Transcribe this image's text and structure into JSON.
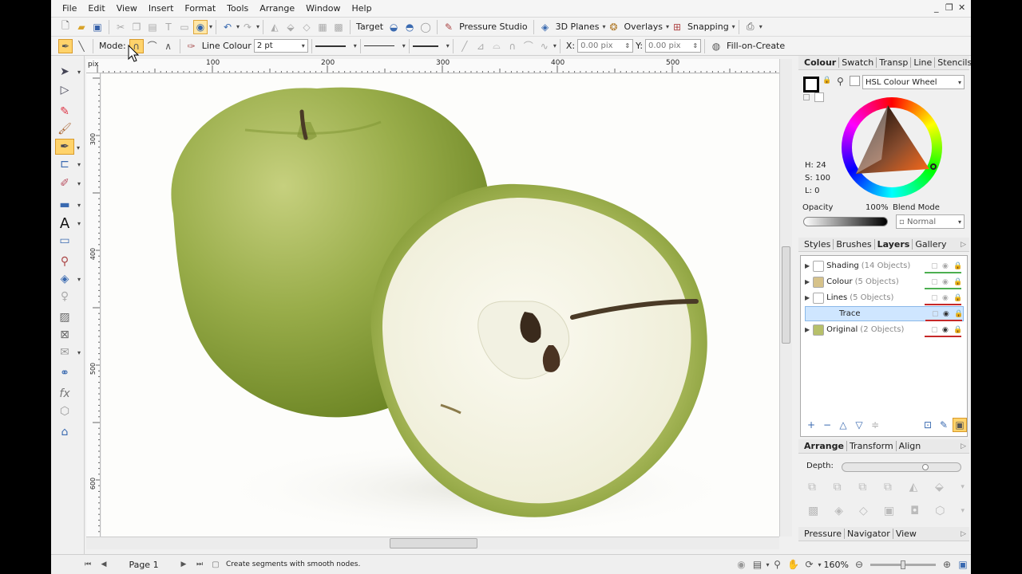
{
  "menu": [
    "File",
    "Edit",
    "View",
    "Insert",
    "Format",
    "Tools",
    "Arrange",
    "Window",
    "Help"
  ],
  "toolbar1": {
    "target_label": "Target",
    "pressure_label": "Pressure Studio",
    "planes_label": "3D Planes",
    "overlays_label": "Overlays",
    "snapping_label": "Snapping"
  },
  "toolbar2": {
    "mode_label": "Mode:",
    "line_colour_label": "Line Colour",
    "line_width": "2 pt",
    "x_label": "X:",
    "x_value": "0.00 pix",
    "y_label": "Y:",
    "y_value": "0.00 pix",
    "fill_on_create": "Fill-on-Create"
  },
  "ruler": {
    "unit": "pix",
    "top_ticks": [
      "100",
      "200",
      "300",
      "400",
      "500"
    ],
    "left_ticks": [
      "300",
      "400",
      "500",
      "600"
    ]
  },
  "colour_panel": {
    "tabs": [
      "Colour",
      "Swatch",
      "Transp",
      "Line",
      "Stencils"
    ],
    "active_tab": "Colour",
    "model": "HSL Colour Wheel",
    "h_label": "H: 24",
    "s_label": "S: 100",
    "l_label": "L: 0",
    "opacity_label": "Opacity",
    "opacity_value": "100%",
    "blend_label": "Blend Mode",
    "blend_value": "Normal"
  },
  "layers_panel": {
    "tabs": [
      "Styles",
      "Brushes",
      "Layers",
      "Gallery"
    ],
    "active_tab": "Layers",
    "layers": [
      {
        "name": "Shading",
        "count": "(14 Objects)",
        "color": "#4caf50",
        "selected": false
      },
      {
        "name": "Colour",
        "count": "(5 Objects)",
        "color": "#4caf50",
        "selected": false
      },
      {
        "name": "Lines",
        "count": "(5 Objects)",
        "color": "#c62828",
        "selected": false
      },
      {
        "name": "Trace",
        "count": "",
        "color": "#c62828",
        "selected": true
      },
      {
        "name": "Original",
        "count": "(2 Objects)",
        "color": "#c62828",
        "selected": false
      }
    ]
  },
  "arrange_panel": {
    "tabs": [
      "Arrange",
      "Transform",
      "Align"
    ],
    "active_tab": "Arrange",
    "depth_label": "Depth:"
  },
  "bottom_tabs": [
    "Pressure",
    "Navigator",
    "View"
  ],
  "status": {
    "page": "Page 1",
    "message": "Create segments with smooth nodes.",
    "zoom": "160%"
  },
  "colors": {
    "accent": "#ffd36b",
    "selection": "#cfe6ff",
    "apple_green": "#8fa63a"
  }
}
